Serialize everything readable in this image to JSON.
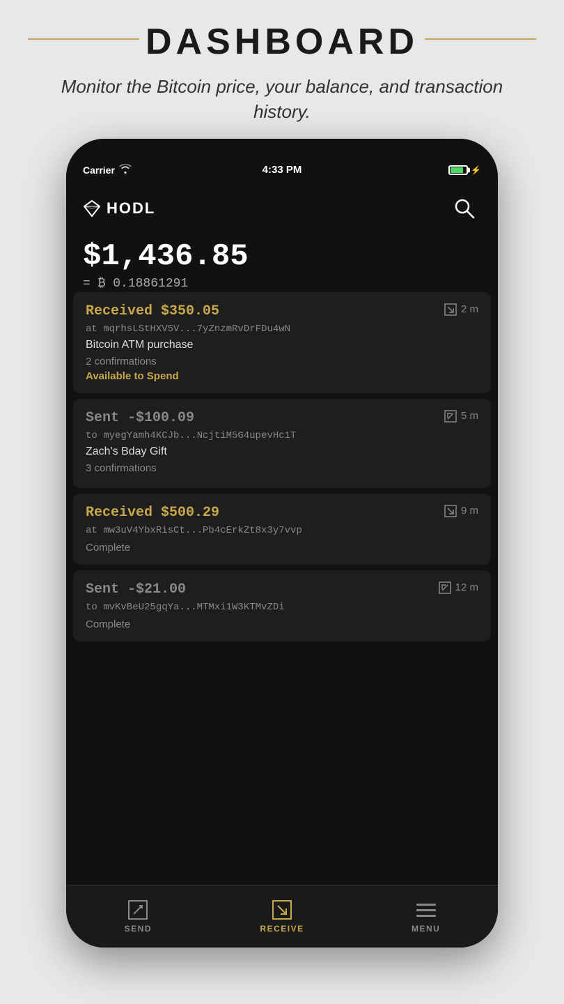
{
  "page": {
    "title": "DASHBOARD",
    "subtitle": "Monitor the Bitcoin price, your balance, and transaction history."
  },
  "status_bar": {
    "carrier": "Carrier",
    "time": "4:33 PM"
  },
  "app": {
    "logo_text": "HODL",
    "balance_usd": "$1,436.85",
    "balance_btc_prefix": "= ₿ ",
    "balance_btc": "0.18861291"
  },
  "transactions": [
    {
      "type": "received",
      "amount": "Received $350.05",
      "address": "at mqrhsLStHXV5V...7yZnzmRvDrFDu4wN",
      "label": "Bitcoin ATM purchase",
      "confirmations": "2 confirmations",
      "status": "Available to Spend",
      "time": "2 m",
      "status_type": "available"
    },
    {
      "type": "sent",
      "amount": "Sent -$100.09",
      "address": "to myegYamh4KCJb...NcjtiM5G4upevHc1T",
      "label": "Zach's Bday Gift",
      "confirmations": "3 confirmations",
      "status": "",
      "time": "5 m",
      "status_type": "none"
    },
    {
      "type": "received",
      "amount": "Received $500.29",
      "address": "at mw3uV4YbxRisCt...Pb4cErkZt8x3y7vvp",
      "label": "",
      "confirmations": "",
      "status": "Complete",
      "time": "9 m",
      "status_type": "complete"
    },
    {
      "type": "sent",
      "amount": "Sent -$21.00",
      "address": "to mvKvBeU25gqYa...MTMxi1W3KTMvZDi",
      "label": "",
      "confirmations": "",
      "status": "Complete",
      "time": "12 m",
      "status_type": "complete"
    }
  ],
  "nav": {
    "send_label": "SEND",
    "receive_label": "RECEIVE",
    "menu_label": "MENU"
  }
}
